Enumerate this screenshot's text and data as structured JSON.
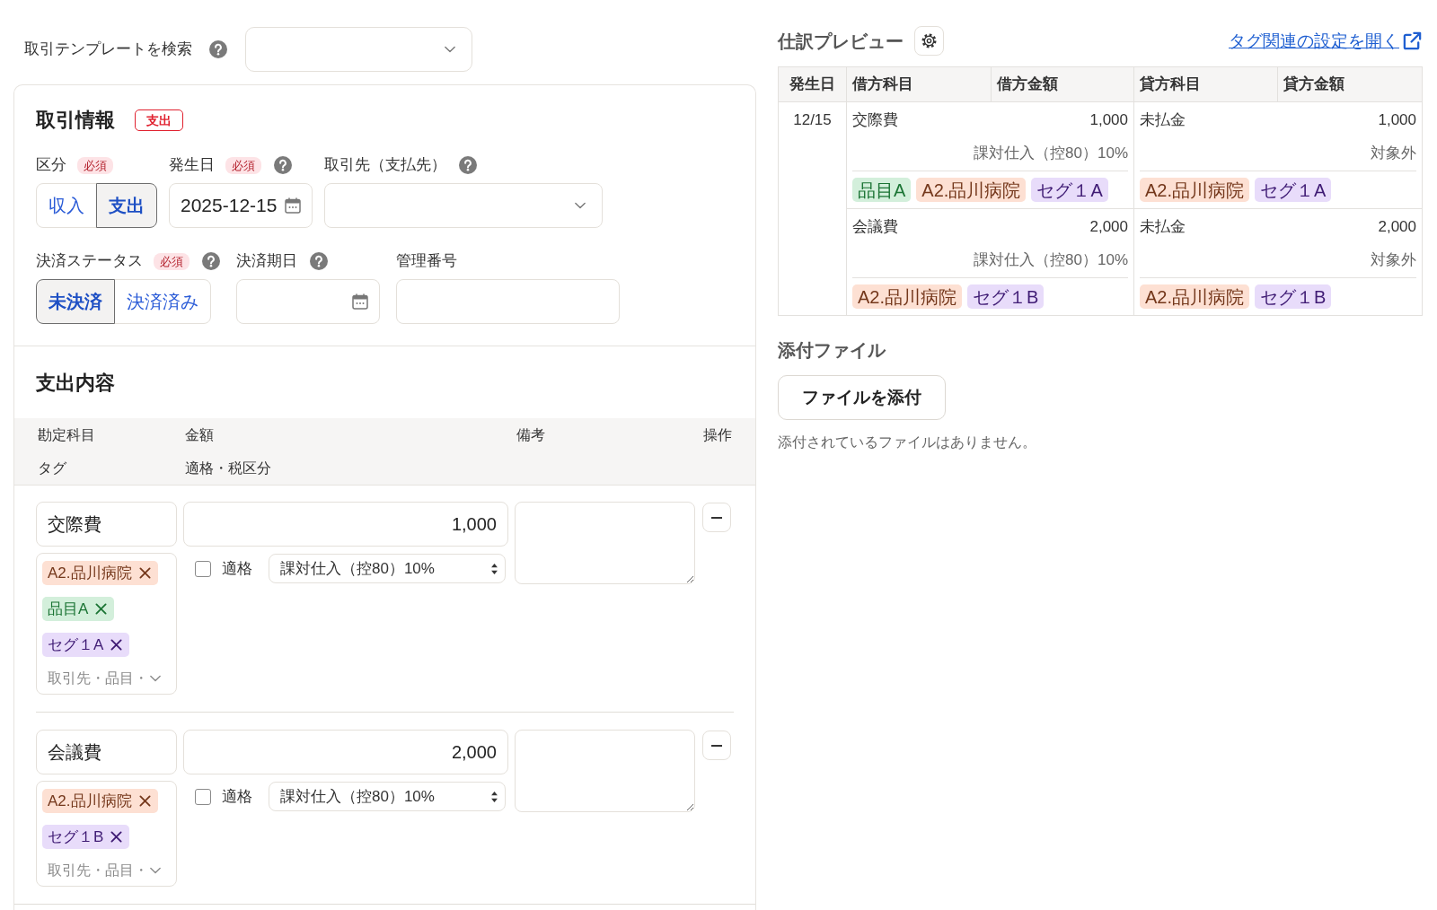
{
  "template_search": {
    "label": "取引テンプレートを検索",
    "help": true
  },
  "transaction_info": {
    "title": "取引情報",
    "type_badge": "支出",
    "rows": [
      [
        {
          "kind": "segmented",
          "label": "区分",
          "badge": "必須",
          "help": false,
          "options": [
            {
              "label": "収入",
              "selected": false
            },
            {
              "label": "支出",
              "selected": true
            }
          ]
        },
        {
          "kind": "date",
          "label": "発生日",
          "badge": "必須",
          "help": true,
          "value": "2025-12-15"
        },
        {
          "kind": "select",
          "label": "取引先（支払先）",
          "help": true
        }
      ],
      [
        {
          "kind": "segmented",
          "label": "決済ステータス",
          "badge": "必須",
          "help": true,
          "options": [
            {
              "label": "未決済",
              "selected": true
            },
            {
              "label": "決済済み",
              "selected": false
            }
          ]
        },
        {
          "kind": "date",
          "label": "決済期日",
          "help": true
        },
        {
          "kind": "text",
          "label": "管理番号",
          "help": false
        }
      ]
    ]
  },
  "expense": {
    "title": "支出内容",
    "header_rows": [
      [
        "勘定科目",
        "金額",
        "備考",
        "操作"
      ],
      [
        "タグ",
        "適格・税区分"
      ]
    ],
    "lines": [
      {
        "account": "交際費",
        "amount": "1,000",
        "tags": [
          {
            "label": "A2.品川病院",
            "color": "#fde0d3"
          },
          {
            "label": "品目A",
            "color": "#d3efdb"
          },
          {
            "label": "セグ１A",
            "color": "#e8dcfa"
          }
        ],
        "tag_placeholder": "取引先・品目・",
        "qualified": false,
        "qualified_label": "適格",
        "tax": "課対仕入（控80）10%"
      },
      {
        "account": "会議費",
        "amount": "2,000",
        "tags": [
          {
            "label": "A2.品川病院",
            "color": "#fde0d3"
          },
          {
            "label": "セグ１B",
            "color": "#e8dcfa"
          }
        ],
        "tag_placeholder": "取引先・品目・",
        "qualified": false,
        "qualified_label": "適格",
        "tax": "課対仕入（控80）10%"
      }
    ]
  },
  "journal_preview": {
    "title": "仕訳プレビュー",
    "settings_link": "タグ関連の設定を開く",
    "columns": [
      "発生日",
      "借方科目",
      "借方金額",
      "貸方科目",
      "貸方金額"
    ],
    "date": "12/15",
    "entries": [
      {
        "debit": {
          "account": "交際費",
          "amount": "1,000",
          "tax": "課対仕入（控80）10%",
          "tags": [
            {
              "label": "品目A",
              "color": "#d3efdb"
            },
            {
              "label": "A2.品川病院",
              "color": "#fde0d3"
            },
            {
              "label": "セグ１A",
              "color": "#e8dcfa"
            }
          ]
        },
        "credit": {
          "account": "未払金",
          "amount": "1,000",
          "tax": "対象外",
          "tags": [
            {
              "label": "A2.品川病院",
              "color": "#fde0d3"
            },
            {
              "label": "セグ１A",
              "color": "#e8dcfa"
            }
          ]
        }
      },
      {
        "debit": {
          "account": "会議費",
          "amount": "2,000",
          "tax": "課対仕入（控80）10%",
          "tags": [
            {
              "label": "A2.品川病院",
              "color": "#fde0d3"
            },
            {
              "label": "セグ１B",
              "color": "#e8dcfa"
            }
          ]
        },
        "credit": {
          "account": "未払金",
          "amount": "2,000",
          "tax": "対象外",
          "tags": [
            {
              "label": "A2.品川病院",
              "color": "#fde0d3"
            },
            {
              "label": "セグ１B",
              "color": "#e8dcfa"
            }
          ]
        }
      }
    ]
  },
  "attachments": {
    "title": "添付ファイル",
    "button": "ファイルを添付",
    "empty_message": "添付されているファイルはありません。"
  }
}
